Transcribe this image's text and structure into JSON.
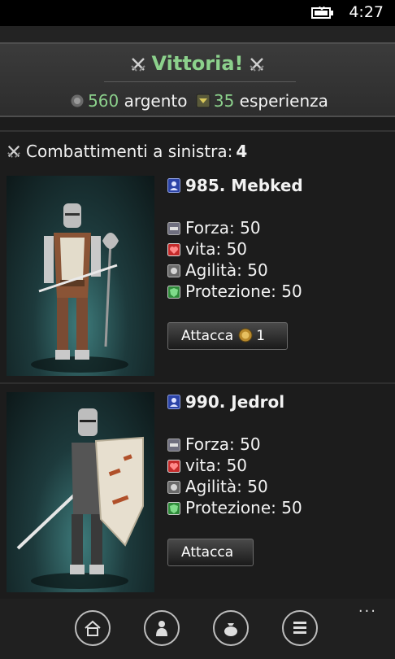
{
  "status": {
    "time": "4:27",
    "battery_icon": "battery-charging-icon"
  },
  "victory": {
    "title": "Vittoria!",
    "silver_amount": "560",
    "silver_label": "argento",
    "xp_amount": "35",
    "xp_label": "esperienza",
    "accent_color": "#8cd18c"
  },
  "fights": {
    "label": "Combattimenti a sinistra:",
    "count": "4"
  },
  "opponents": [
    {
      "name": "985. Mebked",
      "stats": [
        {
          "label": "Forza: 50",
          "icon": "strength-icon"
        },
        {
          "label": "vita: 50",
          "icon": "heart-icon"
        },
        {
          "label": "Agilità: 50",
          "icon": "agility-icon"
        },
        {
          "label": "Protezione: 50",
          "icon": "shield-icon"
        }
      ],
      "attack_label": "Attacca",
      "attack_cost": "1"
    },
    {
      "name": "990. Jedrol",
      "stats": [
        {
          "label": "Forza: 50",
          "icon": "strength-icon"
        },
        {
          "label": "vita: 50",
          "icon": "heart-icon"
        },
        {
          "label": "Agilità: 50",
          "icon": "agility-icon"
        },
        {
          "label": "Protezione: 50",
          "icon": "shield-icon"
        }
      ],
      "attack_label": "Attacca"
    }
  ],
  "appbar": {
    "buttons": [
      "home-icon",
      "character-icon",
      "money-bag-icon",
      "menu-list-icon"
    ],
    "more": "..."
  }
}
